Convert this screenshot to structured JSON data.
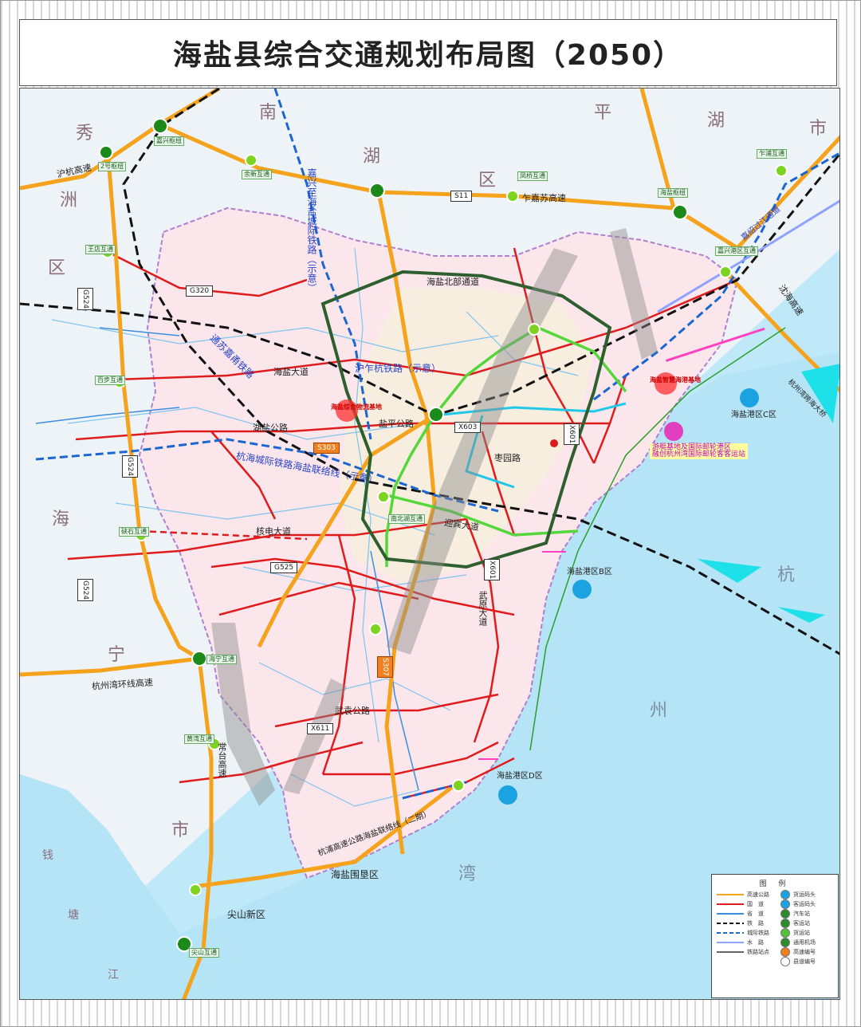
{
  "title": "海盐县综合交通规划布局图（2050）",
  "regions": [
    {
      "text": "秀"
    },
    {
      "text": "洲"
    },
    {
      "text": "区"
    },
    {
      "text": "南"
    },
    {
      "text": "湖"
    },
    {
      "text": "区"
    },
    {
      "text": "平"
    },
    {
      "text": "湖"
    },
    {
      "text": "市"
    },
    {
      "text": "海"
    },
    {
      "text": "宁"
    },
    {
      "text": "市"
    },
    {
      "text": "杭"
    },
    {
      "text": "州"
    },
    {
      "text": "湾"
    },
    {
      "text": "钱"
    },
    {
      "text": "塘"
    },
    {
      "text": "江"
    }
  ],
  "road_labels": [
    {
      "text": "沪杭高速"
    },
    {
      "text": "乍嘉苏高速"
    },
    {
      "text": "海盐北部通道"
    },
    {
      "text": "海盐大道"
    },
    {
      "text": "盐平公路"
    },
    {
      "text": "湖盐公路"
    },
    {
      "text": "核电大道"
    },
    {
      "text": "迎宾大道"
    },
    {
      "text": "枣园路"
    },
    {
      "text": "武原大道"
    },
    {
      "text": "武袁公路"
    },
    {
      "text": "杭州湾环线高速"
    },
    {
      "text": "常台高速"
    },
    {
      "text": "沈海高速"
    },
    {
      "text": "海盐围垦区"
    },
    {
      "text": "尖山新区"
    },
    {
      "text": "杭浦高速公路海盐联络线（二期）"
    },
    {
      "text": "嘉兴至海盐城际铁路（示意）"
    },
    {
      "text": "沪乍杭铁路（示意）"
    },
    {
      "text": "杭海城际铁路海盐联络线（示意）"
    },
    {
      "text": "通苏嘉甬铁路"
    },
    {
      "text": "嘉绍过江通道"
    },
    {
      "text": "杭州湾跨海大桥"
    }
  ],
  "road_badges": [
    {
      "text": "S11"
    },
    {
      "text": "G320"
    },
    {
      "text": "G524"
    },
    {
      "text": "G524"
    },
    {
      "text": "G524"
    },
    {
      "text": "S303"
    },
    {
      "text": "X603"
    },
    {
      "text": "X601"
    },
    {
      "text": "G525"
    },
    {
      "text": "S307"
    },
    {
      "text": "X611"
    },
    {
      "text": "X601"
    }
  ],
  "interchanges": [
    {
      "text": "嘉兴枢纽"
    },
    {
      "text": "2号枢纽"
    },
    {
      "text": "余新互通"
    },
    {
      "text": "凤桥互通"
    },
    {
      "text": "乍浦互通"
    },
    {
      "text": "海盐枢纽"
    },
    {
      "text": "嘉兴港区互通"
    },
    {
      "text": "王店互通"
    },
    {
      "text": "百步互通"
    },
    {
      "text": "硖石互通"
    },
    {
      "text": "海宁互通"
    },
    {
      "text": "黄湾互通"
    },
    {
      "text": "尖山互通"
    },
    {
      "text": "南北湖互通"
    }
  ],
  "ports": [
    {
      "text": "海盐港区C区"
    },
    {
      "text": "海盐港区B区"
    },
    {
      "text": "海盐港区D区"
    }
  ],
  "bases": [
    {
      "text": "海盐综合物流基地"
    },
    {
      "text": "海盐智慧海港基地"
    }
  ],
  "note": {
    "line1": "游艇基地及国际邮轮港区",
    "line2": "融创杭州湾国际邮轮客客运站"
  },
  "legend": {
    "title": "图 例",
    "rows": [
      {
        "line_label": "高速公路",
        "line_color": "#f5a21c",
        "icon_label": "货运码头",
        "icon_color": "#1aa3e0"
      },
      {
        "line_label": "国　道",
        "line_color": "#e01b1b",
        "icon_label": "客运码头",
        "icon_color": "#1aa3e0"
      },
      {
        "line_label": "省　道",
        "line_color": "#3a8de0",
        "icon_label": "汽车站",
        "icon_color": "#2d8a2d"
      },
      {
        "line_label": "铁　路",
        "line_color": "#111111",
        "icon_label": "客运站",
        "icon_color": "#2d8a2d"
      },
      {
        "line_label": "城际铁路",
        "line_color": "#1b66d0",
        "icon_label": "货运站",
        "icon_color": "#55c13a"
      },
      {
        "line_label": "水　路",
        "line_color": "#8fa2ff",
        "icon_label": "通用机场",
        "icon_color": "#2d8a2d"
      },
      {
        "line_label": "铁路站点",
        "line_color": "#666666",
        "icon_label": "高速编号",
        "icon_color": "#f08020"
      },
      {
        "line_label": "",
        "line_color": "",
        "icon_label": "县道编号",
        "icon_color": "#ffffff"
      }
    ]
  }
}
